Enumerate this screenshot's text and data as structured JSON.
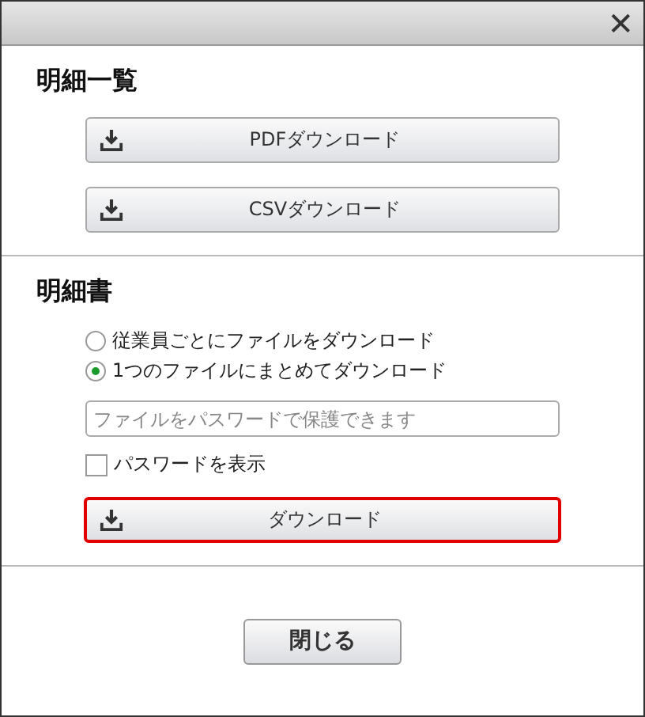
{
  "window": {
    "close": "✕"
  },
  "sections": [
    {
      "title": "明細一覧",
      "buttons": [
        {
          "label": "PDFダウンロード",
          "highlighted": false
        },
        {
          "label": "CSVダウンロード",
          "highlighted": false
        }
      ]
    },
    {
      "title": "明細書",
      "options": [
        {
          "label": "従業員ごとにファイルをダウンロード",
          "selected": false
        },
        {
          "label": "1つのファイルにまとめてダウンロード",
          "selected": true
        }
      ],
      "password": {
        "placeholder": "ファイルをパスワードで保護できます"
      },
      "show_password": {
        "label": "パスワードを表示",
        "checked": false
      },
      "buttons": [
        {
          "label": "ダウンロード",
          "highlighted": true
        }
      ]
    }
  ],
  "footer": {
    "close_button": "閉じる"
  }
}
